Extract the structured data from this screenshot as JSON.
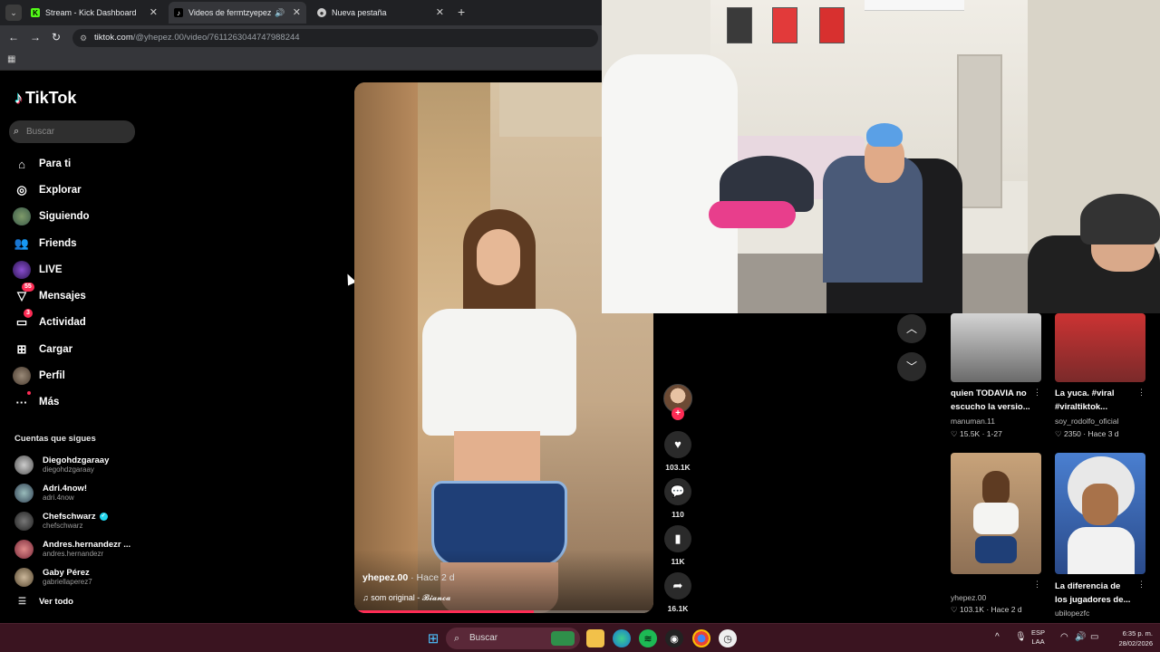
{
  "browser": {
    "tabs": [
      {
        "label": "Stream - Kick Dashboard",
        "active": false
      },
      {
        "label": "Videos de fermtzyepez",
        "active": true
      },
      {
        "label": "Nueva pestaña",
        "active": false
      }
    ],
    "url_host": "tiktok.com",
    "url_path": "/@yhepez.00/video/7611263044747988244"
  },
  "tiktok": {
    "logo": "TikTok",
    "search_placeholder": "Buscar",
    "nav": [
      {
        "label": "Para ti",
        "icon": "home-icon"
      },
      {
        "label": "Explorar",
        "icon": "compass-icon"
      },
      {
        "label": "Siguiendo",
        "icon": "following-avatar-icon"
      },
      {
        "label": "Friends",
        "icon": "friends-icon"
      },
      {
        "label": "LIVE",
        "icon": "live-icon"
      },
      {
        "label": "Mensajes",
        "icon": "messages-icon",
        "badge": "55"
      },
      {
        "label": "Actividad",
        "icon": "activity-icon",
        "badge": "3"
      },
      {
        "label": "Cargar",
        "icon": "upload-icon"
      },
      {
        "label": "Perfil",
        "icon": "profile-avatar-icon"
      },
      {
        "label": "Más",
        "icon": "more-icon"
      }
    ],
    "following_title": "Cuentas que sigues",
    "following": [
      {
        "name": "Diegohdzgaraay",
        "handle": "diegohdzgaraay",
        "verified": false
      },
      {
        "name": "Adri.4now!",
        "handle": "adri.4now",
        "verified": false
      },
      {
        "name": "Chefschwarz",
        "handle": "chefschwarz",
        "verified": true
      },
      {
        "name": "Andres.hernandezr ...",
        "handle": "andres.hernandezr",
        "verified": false
      },
      {
        "name": "Gaby Pérez",
        "handle": "gabriellaperez7",
        "verified": false
      }
    ],
    "see_all": "Ver todo"
  },
  "video": {
    "author": "yhepez.00",
    "ago": "· Hace 2 d",
    "sound_prefix": "som original - ",
    "sound_name": "𝓑𝓲𝓪𝓷𝓬𝓪",
    "progress": 0.6,
    "likes": "103.1K",
    "comments": "110",
    "saves": "11K",
    "shares": "16.1K"
  },
  "recommended": [
    {
      "title1": "quien TODAVIA no",
      "title2": "escucho la versio...",
      "author": "manuman.11",
      "likes": "15.5K",
      "meta": "· 1-27"
    },
    {
      "title1": "La yuca. #viral",
      "title2": "#viraltiktok...",
      "author": "soy_rodolfo_oficial",
      "likes": "2350",
      "meta": "· Hace 3 d"
    },
    {
      "title1": "",
      "title2": "",
      "author": "yhepez.00",
      "likes": "103.1K",
      "meta": "· Hace 2 d"
    },
    {
      "title1": "La diferencia de",
      "title2": "los jugadores de...",
      "author": "ubilopezfc",
      "likes": "",
      "meta": ""
    }
  ],
  "taskbar": {
    "search_placeholder": "Buscar",
    "lang1": "ESP",
    "lang2": "LAA",
    "time": "6:35 p. m.",
    "date": "28/02/2026"
  }
}
